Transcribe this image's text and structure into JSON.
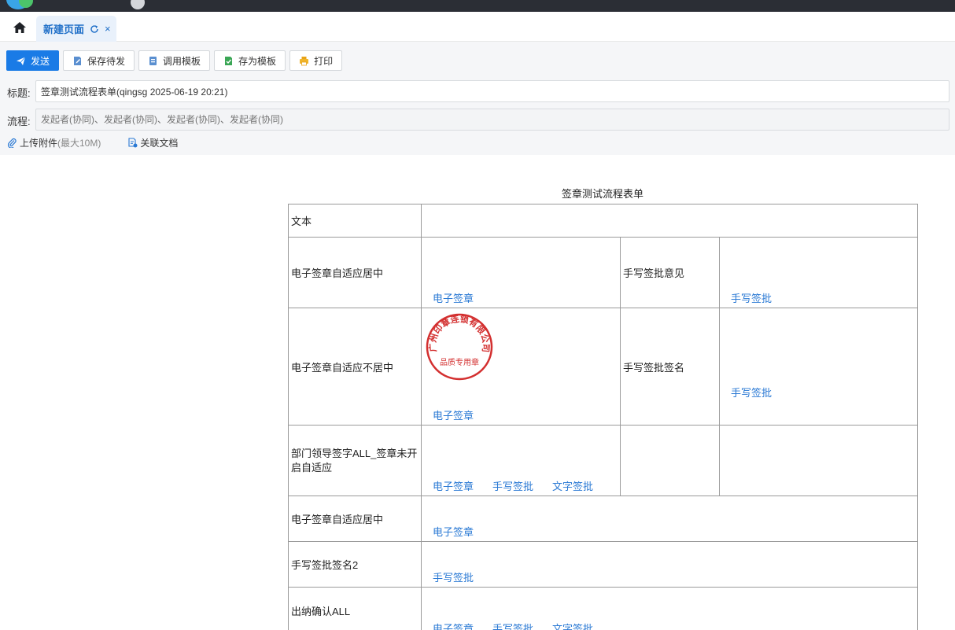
{
  "tabs": {
    "active_label": "新建页面",
    "close_glyph": "×"
  },
  "toolbar": {
    "send_label": "发送",
    "save_label": "保存待发",
    "use_template_label": "调用模板",
    "save_template_label": "存为模板",
    "print_label": "打印"
  },
  "fields": {
    "title_label": "标题:",
    "title_value": "签章测试流程表单(qingsg 2025-06-19 20:21)",
    "flow_label": "流程:",
    "flow_value": "发起者(协同)、发起者(协同)、发起者(协同)、发起者(协同)"
  },
  "attachments": {
    "upload_label": "上传附件",
    "upload_limit": "(最大10M)",
    "related_label": "关联文档"
  },
  "form": {
    "title": "签章测试流程表单",
    "rows": {
      "text_label": "文本",
      "r1_label": "电子签章自适应居中",
      "r1_link": "电子签章",
      "r1_mid_label": "手写签批意见",
      "r1_right_link": "手写签批",
      "r2_label": "电子签章自适应不居中",
      "r2_link": "电子签章",
      "r2_mid_label": "手写签批签名",
      "r2_right_link": "手写签批",
      "r3_label": "部门领导签字ALL_签章未开启自适应",
      "r3_links": [
        "电子签章",
        "手写签批",
        "文字签批"
      ],
      "r4_label": "电子签章自适应居中",
      "r4_link": "电子签章",
      "r5_label": "手写签批签名2",
      "r5_link": "手写签批",
      "r6_label": "出纳确认ALL",
      "r6_links": [
        "电子签章",
        "手写签批",
        "文字签批"
      ]
    },
    "stamp": {
      "ring_text": "广州印章连锁有限公司",
      "center_text": "品质专用章",
      "color": "#d32f2f"
    }
  }
}
